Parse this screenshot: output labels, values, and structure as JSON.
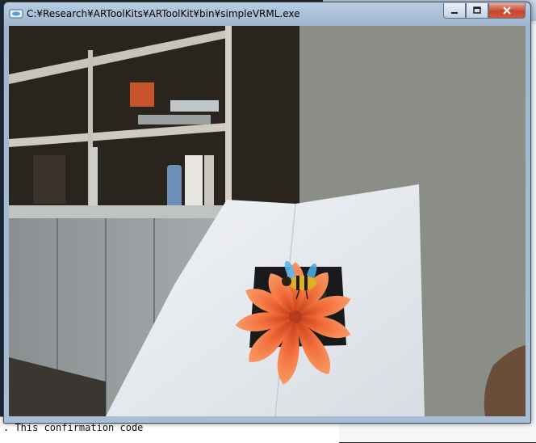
{
  "window": {
    "title": "C:¥Research¥ARToolKits¥ARToolKit¥bin¥simpleVRML.exe",
    "buttons": {
      "minimize_icon": "minimize-icon",
      "maximize_icon": "maximize-icon",
      "close_icon": "close-icon"
    }
  },
  "console": {
    "text": ". This confirmation code"
  },
  "viewport": {
    "description_icon": "camera-feed",
    "colors": {
      "petal": "#f2703a",
      "petal_highlight": "#f7a070",
      "bee_body": "#e0b020",
      "wing": "#4fb4e8"
    }
  }
}
